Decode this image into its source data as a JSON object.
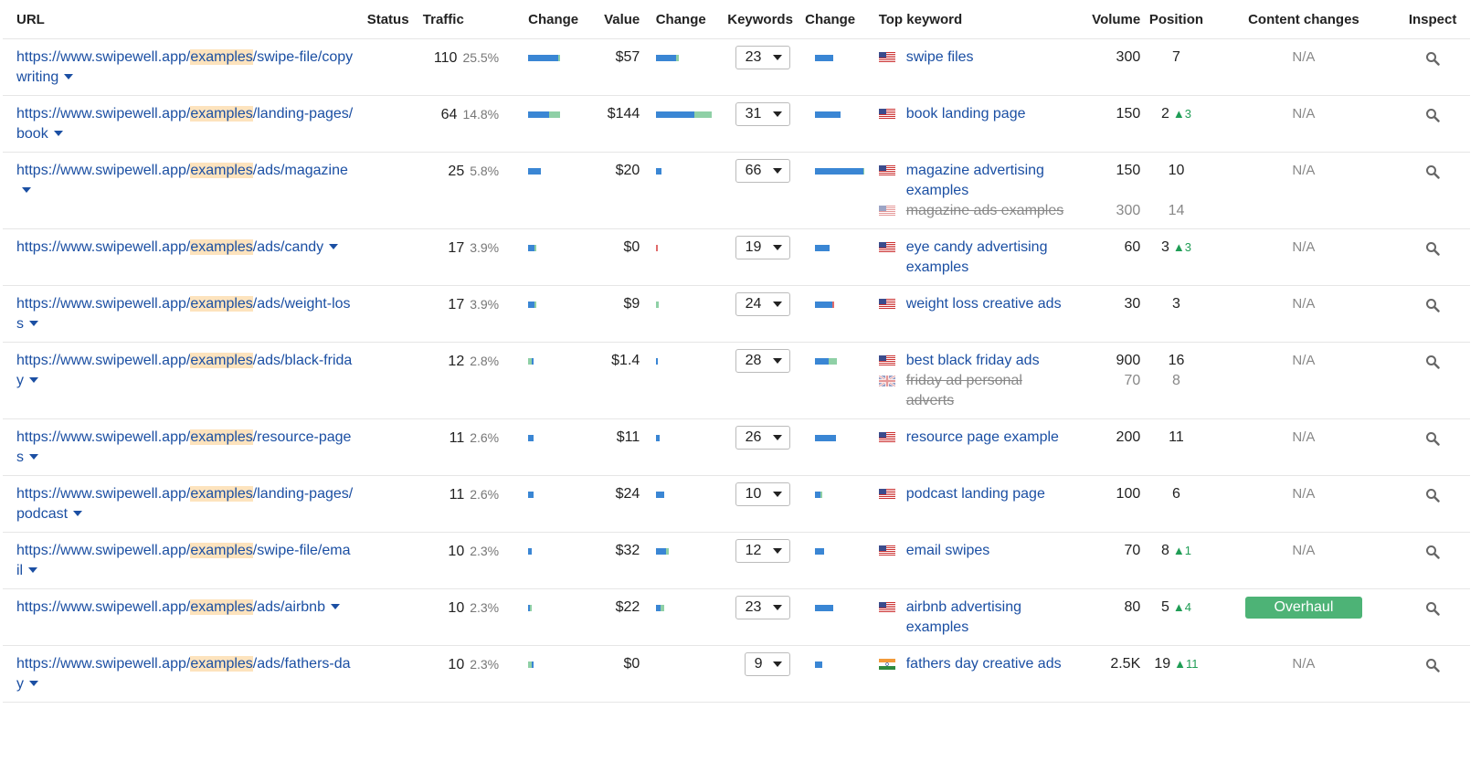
{
  "colors": {
    "link": "#1b4fa3",
    "bar_blue": "#3a86d4",
    "bar_green": "#8fd0a6",
    "bar_red": "#e06b6b",
    "highlight": "#fde3bd",
    "badge_green": "#4db376",
    "up_arrow": "#1f9d55"
  },
  "headers": {
    "url": "URL",
    "status": "Status",
    "traffic": "Traffic",
    "traffic_change": "Change",
    "value": "Value",
    "value_change": "Change",
    "keywords": "Keywords",
    "keywords_change": "Change",
    "top_keyword": "Top keyword",
    "volume": "Volume",
    "position": "Position",
    "content_changes": "Content changes",
    "inspect": "Inspect"
  },
  "rows": [
    {
      "url_prefix": "https://www.swipewell.app/",
      "url_highlight": "examples",
      "url_suffix": "/swipe-file/copywriting",
      "traffic": "110",
      "traffic_pct": "25.5%",
      "traffic_bar": [
        [
          "blue",
          0.9
        ],
        [
          "green",
          0.05
        ]
      ],
      "value": "$57",
      "value_bar": [
        [
          "blue",
          0.35
        ],
        [
          "green",
          0.05
        ]
      ],
      "keywords": "23",
      "kw_bar": [
        [
          "blue",
          0.35
        ]
      ],
      "kw": [
        {
          "flag": "us",
          "text": "swipe files",
          "volume": "300",
          "position": "7",
          "change": "",
          "old": false
        }
      ],
      "content_changes": "N/A",
      "badge": false
    },
    {
      "url_prefix": "https://www.swipewell.app/",
      "url_highlight": "examples",
      "url_suffix": "/landing-pages/book",
      "traffic": "64",
      "traffic_pct": "14.8%",
      "traffic_bar": [
        [
          "blue",
          0.38
        ],
        [
          "green",
          0.2
        ]
      ],
      "value": "$144",
      "value_bar": [
        [
          "blue",
          0.68
        ],
        [
          "green",
          0.3
        ]
      ],
      "keywords": "31",
      "kw_bar": [
        [
          "blue",
          0.48
        ]
      ],
      "kw": [
        {
          "flag": "us",
          "text": "book landing page",
          "volume": "150",
          "position": "2",
          "change": "3",
          "old": false
        }
      ],
      "content_changes": "N/A",
      "badge": false
    },
    {
      "url_prefix": "https://www.swipewell.app/",
      "url_highlight": "examples",
      "url_suffix": "/ads/magazine",
      "traffic": "25",
      "traffic_pct": "5.8%",
      "traffic_bar": [
        [
          "blue",
          0.22
        ]
      ],
      "value": "$20",
      "value_bar": [
        [
          "blue",
          0.1
        ]
      ],
      "keywords": "66",
      "kw_bar": [
        [
          "blue",
          0.95
        ],
        [
          "green",
          0.03
        ]
      ],
      "kw": [
        {
          "flag": "us",
          "text": "magazine advertising examples",
          "volume": "150",
          "position": "10",
          "change": "",
          "old": false
        },
        {
          "flag": "us",
          "text": "magazine ads examples",
          "volume": "300",
          "position": "14",
          "change": "",
          "old": true
        }
      ],
      "content_changes": "N/A",
      "badge": false
    },
    {
      "url_prefix": "https://www.swipewell.app/",
      "url_highlight": "examples",
      "url_suffix": "/ads/candy",
      "traffic": "17",
      "traffic_pct": "3.9%",
      "traffic_bar": [
        [
          "blue",
          0.12
        ],
        [
          "green",
          0.03
        ]
      ],
      "value": "$0",
      "value_bar": [
        [
          "red",
          0.03
        ]
      ],
      "keywords": "19",
      "kw_bar": [
        [
          "blue",
          0.28
        ]
      ],
      "kw": [
        {
          "flag": "us",
          "text": "eye candy advertising examples",
          "volume": "60",
          "position": "3",
          "change": "3",
          "old": false
        }
      ],
      "content_changes": "N/A",
      "badge": false
    },
    {
      "url_prefix": "https://www.swipewell.app/",
      "url_highlight": "examples",
      "url_suffix": "/ads/weight-loss",
      "traffic": "17",
      "traffic_pct": "3.9%",
      "traffic_bar": [
        [
          "blue",
          0.11
        ],
        [
          "green",
          0.04
        ]
      ],
      "value": "$9",
      "value_bar": [
        [
          "green",
          0.05
        ]
      ],
      "keywords": "24",
      "kw_bar": [
        [
          "blue",
          0.33
        ],
        [
          "red",
          0.04
        ]
      ],
      "kw": [
        {
          "flag": "us",
          "text": "weight loss creative ads",
          "volume": "30",
          "position": "3",
          "change": "",
          "old": false
        }
      ],
      "content_changes": "N/A",
      "badge": false
    },
    {
      "url_prefix": "https://www.swipewell.app/",
      "url_highlight": "examples",
      "url_suffix": "/ads/black-friday",
      "traffic": "12",
      "traffic_pct": "2.8%",
      "traffic_bar": [
        [
          "green",
          0.06
        ],
        [
          "blue",
          0.04
        ]
      ],
      "value": "$1.4",
      "value_bar": [
        [
          "blue",
          0.03
        ]
      ],
      "keywords": "28",
      "kw_bar": [
        [
          "blue",
          0.25
        ],
        [
          "green",
          0.15
        ]
      ],
      "kw": [
        {
          "flag": "us",
          "text": "best black friday ads",
          "volume": "900",
          "position": "16",
          "change": "",
          "old": false
        },
        {
          "flag": "uk",
          "text": "friday ad personal adverts",
          "volume": "70",
          "position": "8",
          "change": "",
          "old": true
        }
      ],
      "content_changes": "N/A",
      "badge": false
    },
    {
      "url_prefix": "https://www.swipewell.app/",
      "url_highlight": "examples",
      "url_suffix": "/resource-pages",
      "traffic": "11",
      "traffic_pct": "2.6%",
      "traffic_bar": [
        [
          "blue",
          0.1
        ]
      ],
      "value": "$11",
      "value_bar": [
        [
          "blue",
          0.07
        ]
      ],
      "keywords": "26",
      "kw_bar": [
        [
          "blue",
          0.4
        ]
      ],
      "kw": [
        {
          "flag": "us",
          "text": "resource page example",
          "volume": "200",
          "position": "11",
          "change": "",
          "old": false
        }
      ],
      "content_changes": "N/A",
      "badge": false
    },
    {
      "url_prefix": "https://www.swipewell.app/",
      "url_highlight": "examples",
      "url_suffix": "/landing-pages/podcast",
      "traffic": "11",
      "traffic_pct": "2.6%",
      "traffic_bar": [
        [
          "blue",
          0.1
        ]
      ],
      "value": "$24",
      "value_bar": [
        [
          "blue",
          0.15
        ]
      ],
      "keywords": "10",
      "kw_bar": [
        [
          "blue",
          0.1
        ],
        [
          "green",
          0.04
        ]
      ],
      "kw": [
        {
          "flag": "us",
          "text": "podcast landing page",
          "volume": "100",
          "position": "6",
          "change": "",
          "old": false
        }
      ],
      "content_changes": "N/A",
      "badge": false
    },
    {
      "url_prefix": "https://www.swipewell.app/",
      "url_highlight": "examples",
      "url_suffix": "/swipe-file/email",
      "traffic": "10",
      "traffic_pct": "2.3%",
      "traffic_bar": [
        [
          "blue",
          0.07
        ]
      ],
      "value": "$32",
      "value_bar": [
        [
          "blue",
          0.17
        ],
        [
          "green",
          0.05
        ]
      ],
      "keywords": "12",
      "kw_bar": [
        [
          "blue",
          0.18
        ]
      ],
      "kw": [
        {
          "flag": "us",
          "text": "email swipes",
          "volume": "70",
          "position": "8",
          "change": "1",
          "old": false
        }
      ],
      "content_changes": "N/A",
      "badge": false
    },
    {
      "url_prefix": "https://www.swipewell.app/",
      "url_highlight": "examples",
      "url_suffix": "/ads/airbnb",
      "traffic": "10",
      "traffic_pct": "2.3%",
      "traffic_bar": [
        [
          "blue",
          0.04
        ],
        [
          "green",
          0.04
        ]
      ],
      "value": "$22",
      "value_bar": [
        [
          "blue",
          0.08
        ],
        [
          "green",
          0.07
        ]
      ],
      "keywords": "23",
      "kw_bar": [
        [
          "blue",
          0.35
        ]
      ],
      "kw": [
        {
          "flag": "us",
          "text": "airbnb advertising examples",
          "volume": "80",
          "position": "5",
          "change": "4",
          "old": false
        }
      ],
      "content_changes": "Overhaul",
      "badge": true
    },
    {
      "url_prefix": "https://www.swipewell.app/",
      "url_highlight": "examples",
      "url_suffix": "/ads/fathers-day",
      "traffic": "10",
      "traffic_pct": "2.3%",
      "traffic_bar": [
        [
          "green",
          0.07
        ],
        [
          "blue",
          0.03
        ]
      ],
      "value": "$0",
      "value_bar": [],
      "keywords": "9",
      "kw_bar": [
        [
          "blue",
          0.14
        ]
      ],
      "kw": [
        {
          "flag": "in",
          "text": "fathers day creative ads",
          "volume": "2.5K",
          "position": "19",
          "change": "11",
          "old": false
        }
      ],
      "content_changes": "N/A",
      "badge": false
    }
  ]
}
